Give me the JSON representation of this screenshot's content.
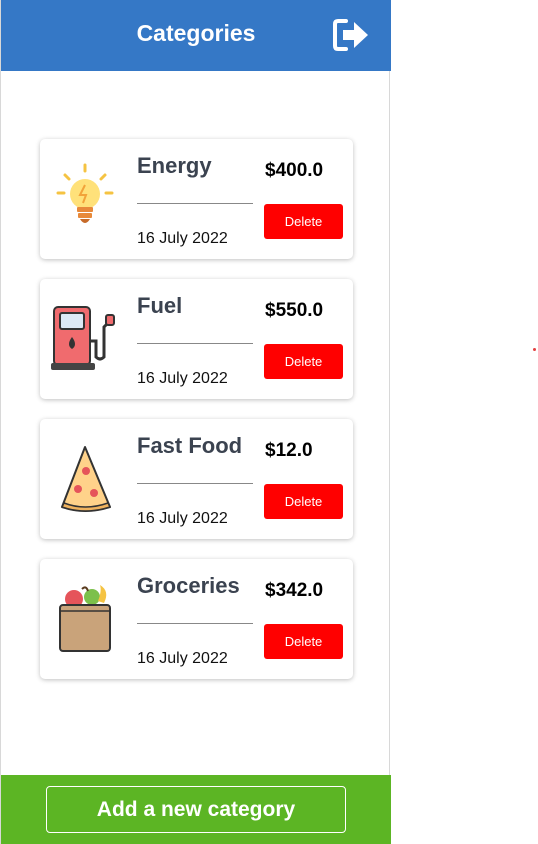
{
  "header": {
    "title": "Categories",
    "logout_icon": "sign-out-icon"
  },
  "categories": [
    {
      "name": "Energy",
      "amount": "$400.0",
      "date": "16 July 2022",
      "delete_label": "Delete",
      "icon": "lightbulb-icon"
    },
    {
      "name": "Fuel",
      "amount": "$550.0",
      "date": "16 July 2022",
      "delete_label": "Delete",
      "icon": "fuel-pump-icon"
    },
    {
      "name": "Fast Food",
      "amount": "$12.0",
      "date": "16 July 2022",
      "delete_label": "Delete",
      "icon": "pizza-slice-icon"
    },
    {
      "name": "Groceries",
      "amount": "$342.0",
      "date": "16 July 2022",
      "delete_label": "Delete",
      "icon": "grocery-bag-icon"
    }
  ],
  "footer": {
    "add_label": "Add a new category"
  },
  "colors": {
    "header": "#3578c6",
    "footer": "#5cb524",
    "delete": "#ff0000"
  }
}
